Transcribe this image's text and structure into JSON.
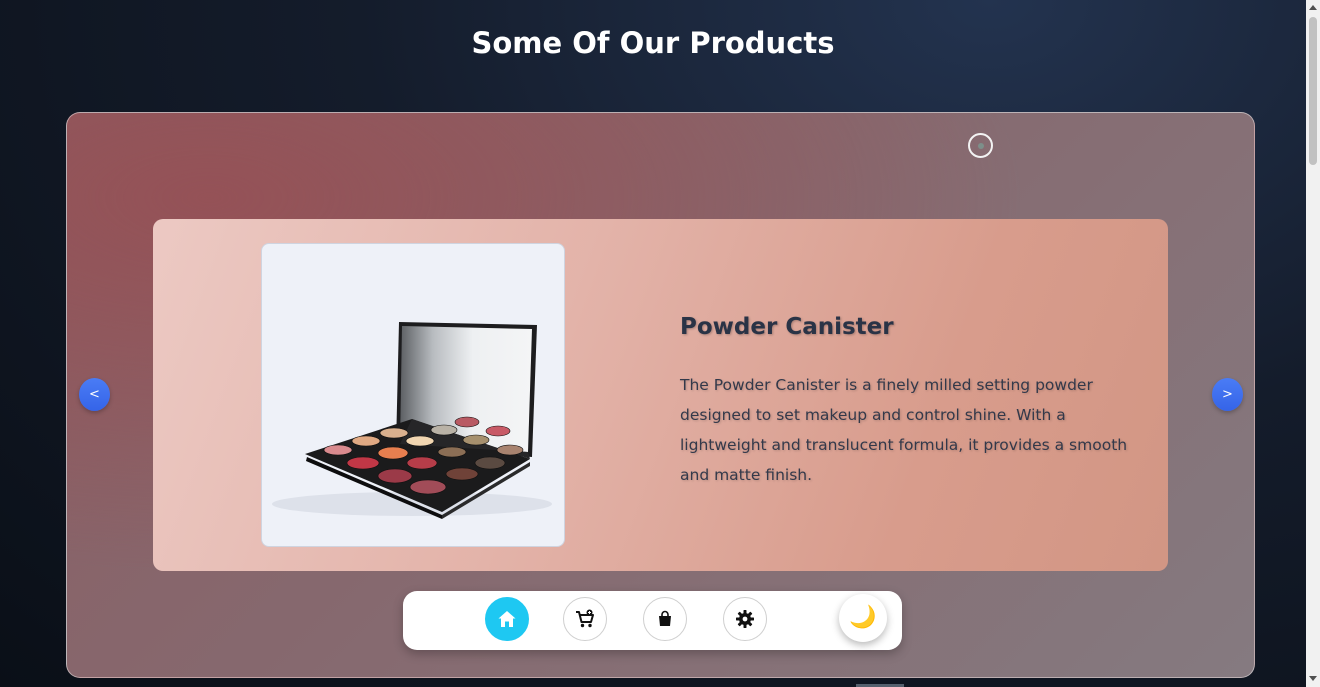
{
  "page": {
    "title": "Some Of Our Products"
  },
  "carousel": {
    "prev_label": "<",
    "next_label": ">",
    "slide": {
      "product_name": "Powder Canister",
      "description": "The Powder Canister is a finely milled setting powder designed to set makeup and control shine. With a lightweight and translucent formula, it provides a smooth and matte finish.",
      "image_subject": "eyeshadow-palette-with-mirror"
    }
  },
  "bottom_nav": {
    "items": [
      {
        "icon": "home-icon",
        "active": true
      },
      {
        "icon": "cart-add-icon",
        "active": false
      },
      {
        "icon": "shopping-bag-icon",
        "active": false
      },
      {
        "icon": "gear-icon",
        "active": false
      }
    ],
    "theme_toggle_icon": "🌙"
  },
  "colors": {
    "accent": "#1ec8f2",
    "nav_button": "#3f6ff0",
    "title": "#ffffff",
    "product_title": "#2a3346"
  }
}
